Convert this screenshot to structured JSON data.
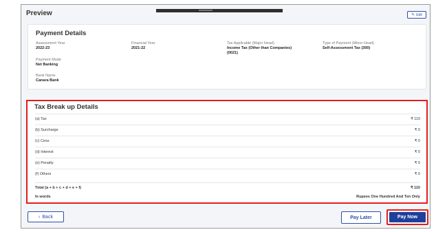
{
  "header": {
    "title": "Preview",
    "edit_label": "Edit",
    "edit_icon": "pencil-icon"
  },
  "payment": {
    "heading": "Payment Details",
    "assessment_year_label": "Assessment Year",
    "assessment_year": "2022-23",
    "financial_year_label": "Financial Year",
    "financial_year": "2021-22",
    "tax_applicable_label": "Tax Applicable (Major Head)",
    "tax_applicable_line1": "Income Tax (Other than Companies)",
    "tax_applicable_line2": "(0021)",
    "payment_type_label": "Type of Payment (Minor Head)",
    "payment_type": "Self-Assessment Tax (300)",
    "payment_mode_label": "Payment Mode",
    "payment_mode": "Net Banking",
    "bank_name_label": "Bank Name",
    "bank_name": "Canara Bank"
  },
  "tax_breakup": {
    "heading": "Tax Break up Details",
    "rows": [
      {
        "label": "(a) Tax",
        "amount": "₹ 110"
      },
      {
        "label": "(b) Surcharge",
        "amount": "₹ 0"
      },
      {
        "label": "(c) Cess",
        "amount": "₹ 0"
      },
      {
        "label": "(d) Interest",
        "amount": "₹ 0"
      },
      {
        "label": "(e) Penalty",
        "amount": "₹ 0"
      },
      {
        "label": "(f) Others",
        "amount": "₹ 0"
      }
    ],
    "total_label": "Total (a + b + c + d + e + f)",
    "total_amount": "₹ 110",
    "words_label": "In words",
    "words_value": "Rupees One Hundred And Ten Only"
  },
  "actions": {
    "back_label": "Back",
    "back_icon": "chevron-left-icon",
    "pay_later_label": "Pay Later",
    "pay_now_label": "Pay Now"
  },
  "colors": {
    "accent": "#2b4fa8",
    "primary_button": "#1f3f9c",
    "highlight_border": "#e31d1d"
  }
}
